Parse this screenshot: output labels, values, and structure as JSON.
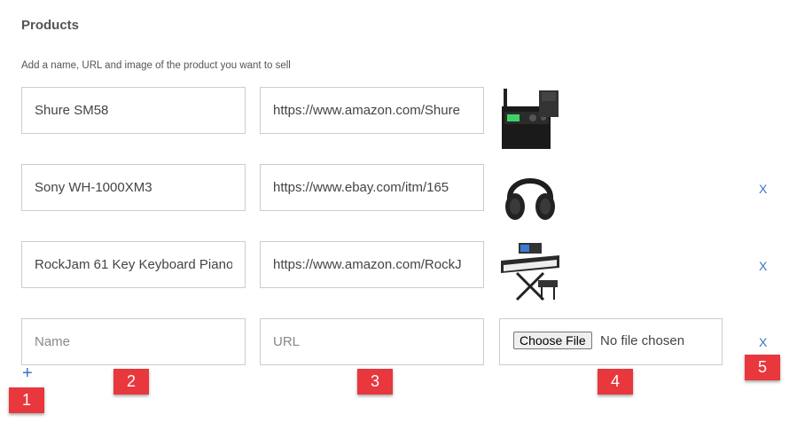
{
  "section": {
    "title": "Products",
    "description": "Add a name, URL and image of the product you want to sell"
  },
  "products": [
    {
      "name": "Shure SM58",
      "url": "https://www.amazon.com/Shure",
      "image": "wireless-microphone-receiver",
      "removable": false
    },
    {
      "name": "Sony WH-1000XM3",
      "url": "https://www.ebay.com/itm/165",
      "image": "headphones",
      "removable": true,
      "remove_label": "X"
    },
    {
      "name": "RockJam 61 Key Keyboard Piano",
      "url": "https://www.amazon.com/RockJ",
      "image": "keyboard-piano-with-stand",
      "removable": true,
      "remove_label": "X"
    }
  ],
  "new_product": {
    "name_placeholder": "Name",
    "url_placeholder": "URL",
    "choose_file_label": "Choose File",
    "file_status": "No file chosen",
    "remove_label": "X"
  },
  "add_label": "+",
  "badges": [
    "1",
    "2",
    "3",
    "4",
    "5"
  ],
  "colors": {
    "accent": "#3b73c0",
    "badge": "#e8373d",
    "border": "#cccccc"
  }
}
